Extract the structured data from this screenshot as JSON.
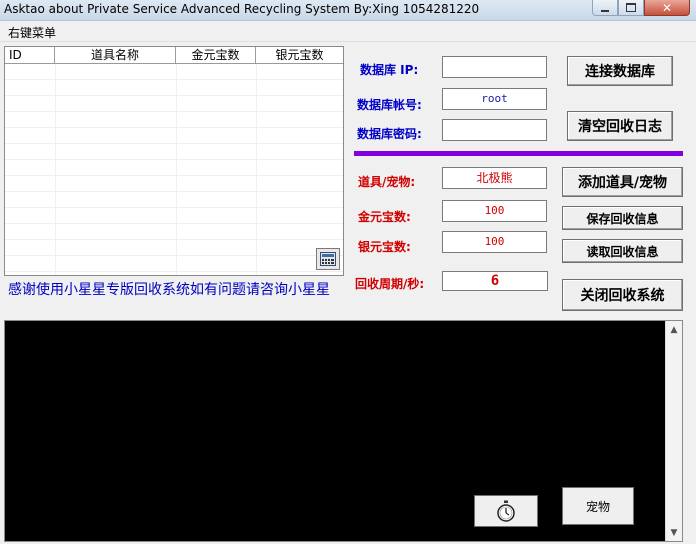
{
  "window": {
    "title": "Asktao about Private Service Advanced Recycling System By:Xing 1054281220",
    "min_icon": "minimize-icon",
    "max_icon": "maximize-icon",
    "close_icon": "close-icon"
  },
  "menu": {
    "items": [
      "右键菜单"
    ]
  },
  "list": {
    "columns": [
      "ID",
      "道具名称",
      "金元宝数",
      "银元宝数"
    ],
    "rows": []
  },
  "calc_button": {
    "icon": "calculator-icon"
  },
  "thanks_text": "感谢使用小星星专版回收系统如有问题请咨询小星星",
  "db": {
    "ip_label": "数据库 IP:",
    "ip_value": "",
    "account_label": "数据库帐号:",
    "account_value": "root",
    "password_label": "数据库密码:",
    "password_value": ""
  },
  "buttons": {
    "connect": "连接数据库",
    "clear_log": "清空回收日志",
    "add_item": "添加道具/宠物",
    "save_info": "保存回收信息",
    "read_info": "读取回收信息",
    "close_system": "关闭回收系统",
    "pet": "宠物",
    "timer_icon": "stopwatch-icon"
  },
  "recycle": {
    "item_label": "道具/宠物:",
    "item_value": "北极熊",
    "gold_label": "金元宝数:",
    "gold_value": "100",
    "silver_label": "银元宝数:",
    "silver_value": "100",
    "cycle_label": "回收周期/秒:",
    "cycle_value": "6"
  },
  "colors": {
    "label_blue": "#0000c8",
    "label_red": "#d00000",
    "divider": "#8000e0",
    "log_bg": "#000000"
  }
}
